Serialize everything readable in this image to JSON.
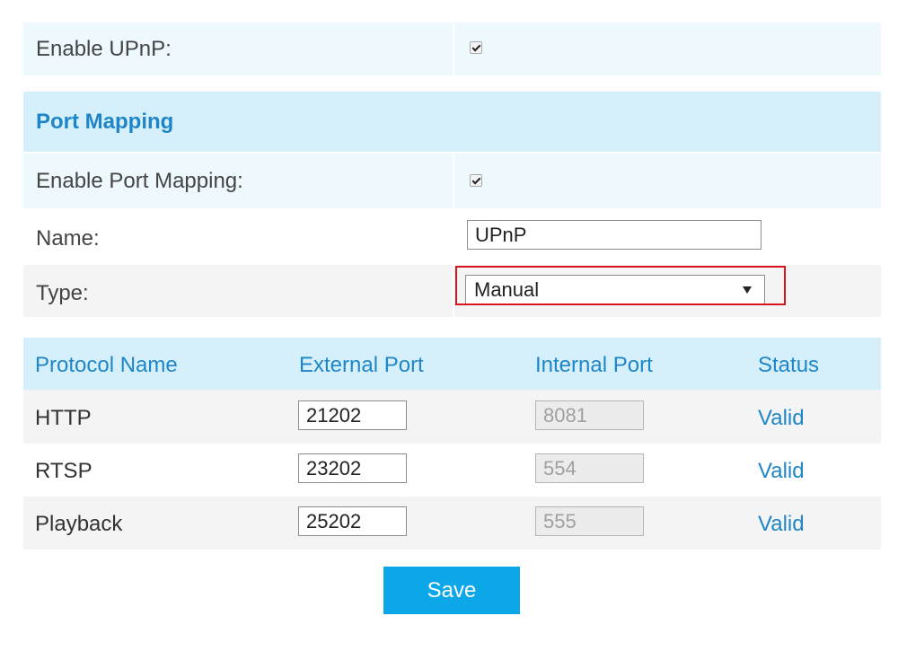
{
  "upnp": {
    "label": "Enable UPnP:"
  },
  "port_mapping": {
    "title": "Port Mapping",
    "enable_label": "Enable Port Mapping:",
    "name_label": "Name:",
    "name_value": "UPnP",
    "type_label": "Type:",
    "type_value": "Manual"
  },
  "table": {
    "headers": [
      "Protocol Name",
      "External Port",
      "Internal Port",
      "Status"
    ],
    "rows": [
      {
        "protocol": "HTTP",
        "external": "21202",
        "internal": "8081",
        "status": "Valid"
      },
      {
        "protocol": "RTSP",
        "external": "23202",
        "internal": "554",
        "status": "Valid"
      },
      {
        "protocol": "Playback",
        "external": "25202",
        "internal": "555",
        "status": "Valid"
      }
    ]
  },
  "actions": {
    "save_label": "Save"
  },
  "colors": {
    "accent": "#1e86c8",
    "header_bg": "#d6f0fb",
    "button_bg": "#0ba7e8",
    "highlight": "#d9141c"
  }
}
